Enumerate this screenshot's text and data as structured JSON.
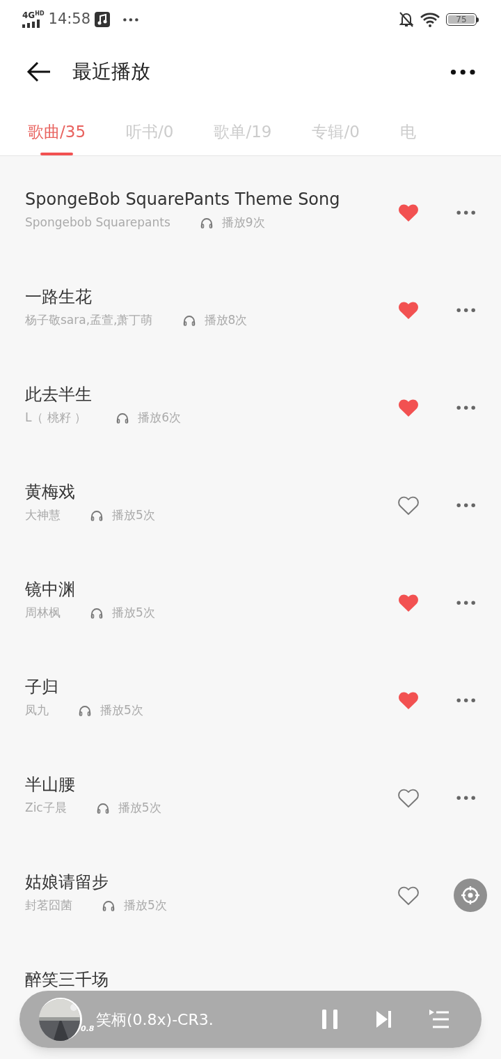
{
  "status_bar": {
    "network": "4G",
    "network_sup": "HD",
    "time": "14:58",
    "battery": "75"
  },
  "header": {
    "title": "最近播放"
  },
  "tabs": [
    {
      "label": "歌曲/35",
      "selected": true
    },
    {
      "label": "听书/0",
      "selected": false
    },
    {
      "label": "歌单/19",
      "selected": false
    },
    {
      "label": "专辑/0",
      "selected": false
    },
    {
      "label": "电",
      "selected": false
    }
  ],
  "songs": [
    {
      "title": "SpongeBob SquarePants Theme Song",
      "artist": "Spongebob Squarepants",
      "plays": "播放9次",
      "liked": true,
      "more": true
    },
    {
      "title": "一路生花",
      "artist": "杨子敬sara,孟萱,萧丁萌",
      "plays": "播放8次",
      "liked": true,
      "more": true
    },
    {
      "title": "此去半生",
      "artist": "L（ 桃籽 ）",
      "plays": "播放6次",
      "liked": true,
      "more": true
    },
    {
      "title": "黄梅戏",
      "artist": "大神慧",
      "plays": "播放5次",
      "liked": false,
      "more": true
    },
    {
      "title": "镜中渊",
      "artist": "周林枫",
      "plays": "播放5次",
      "liked": true,
      "more": true
    },
    {
      "title": "子归",
      "artist": "凤九",
      "plays": "播放5次",
      "liked": true,
      "more": true
    },
    {
      "title": "半山腰",
      "artist": "Zic子晨",
      "plays": "播放5次",
      "liked": false,
      "more": true
    },
    {
      "title": "姑娘请留步",
      "artist": "封茗囧菌",
      "plays": "播放5次",
      "liked": false,
      "more": false
    },
    {
      "title": "醉笑三千场"
    }
  ],
  "player": {
    "speed": "0.8",
    "title": "笑柄(0.8x)-CR3.",
    "playing": true
  }
}
